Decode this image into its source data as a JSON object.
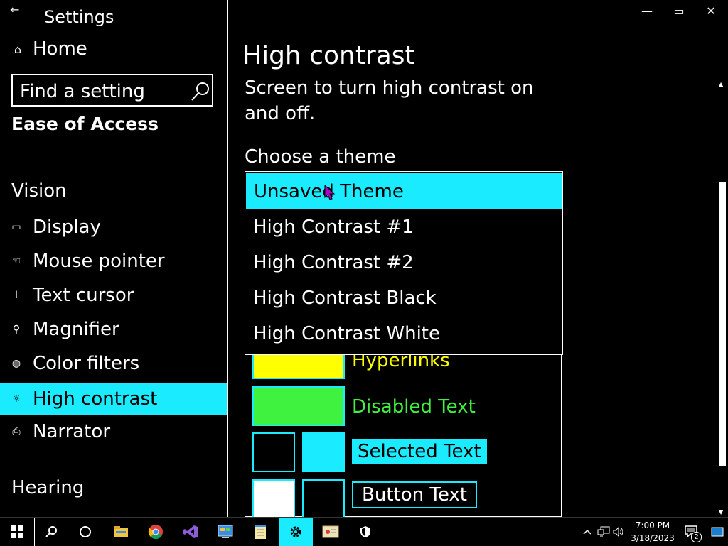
{
  "window": {
    "title": "Settings",
    "minimize": "—",
    "maximize": "▭",
    "close": "✕"
  },
  "sidebar": {
    "back_glyph": "←",
    "home": {
      "label": "Home",
      "icon": "home-icon",
      "glyph": "⌂"
    },
    "search": {
      "placeholder": "Find a setting",
      "icon": "search-icon"
    },
    "section": "Ease of Access",
    "vision_header": "Vision",
    "items": [
      {
        "label": "Display",
        "icon": "display-icon",
        "glyph": "▭"
      },
      {
        "label": "Mouse pointer",
        "icon": "mouse-pointer-icon",
        "glyph": "☜"
      },
      {
        "label": "Text cursor",
        "icon": "text-cursor-icon",
        "glyph": "I"
      },
      {
        "label": "Magnifier",
        "icon": "magnifier-icon",
        "glyph": "⚲"
      },
      {
        "label": "Color filters",
        "icon": "color-filters-icon",
        "glyph": "◍"
      },
      {
        "label": "High contrast",
        "icon": "high-contrast-icon",
        "glyph": "☼",
        "active": true
      },
      {
        "label": "Narrator",
        "icon": "narrator-icon",
        "glyph": "⎙"
      }
    ],
    "hearing_header": "Hearing"
  },
  "main": {
    "title": "High contrast",
    "description": "Screen to turn high contrast on and off.",
    "choose_label": "Choose a theme",
    "theme_options": [
      "Unsaved Theme",
      "High Contrast #1",
      "High Contrast #2",
      "High Contrast Black",
      "High Contrast White"
    ],
    "selected_theme": "Unsaved Theme",
    "preview": {
      "hyperlinks": "Hyperlinks",
      "disabled_text": "Disabled Text",
      "selected_text": "Selected Text",
      "button_text": "Button Text"
    }
  },
  "colors": {
    "accent": "#1aebff",
    "hyperlink": "#ffff00",
    "disabled": "#3ff23f",
    "background": "#000000",
    "text": "#ffffff"
  },
  "taskbar": {
    "apps": [
      "start-icon",
      "search-icon",
      "cortana-icon",
      "file-explorer-icon",
      "chrome-icon",
      "visual-studio-icon",
      "control-panel-icon",
      "notepad-icon",
      "settings-icon",
      "certificate-icon",
      "security-icon"
    ],
    "active_app": "settings-icon",
    "clock_time": "7:00 PM",
    "clock_date": "3/18/2023",
    "notification_count": "2"
  }
}
